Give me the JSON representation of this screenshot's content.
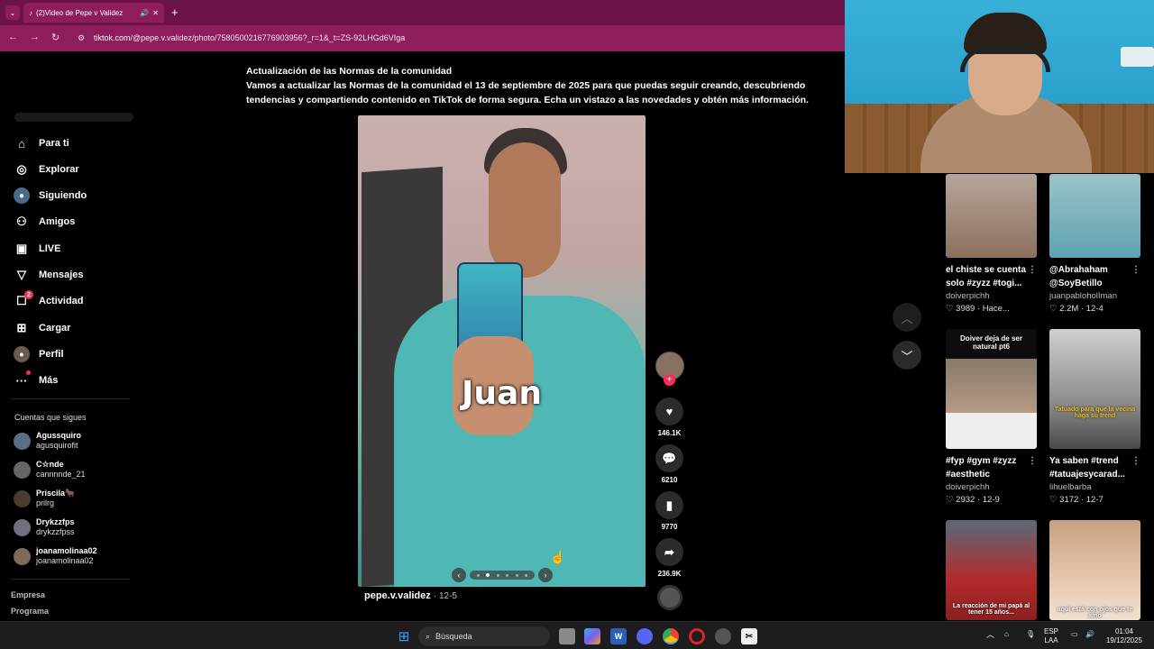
{
  "browser": {
    "tab_title": "(2)Video de Pepe v Validez",
    "url_host": "tiktok.com",
    "url_path": "/@pepe.v.validez/photo/7580500216776903956?_r=1&_t=ZS-92LHGd6VIga"
  },
  "notice": {
    "title": "Actualización de las Normas de la comunidad",
    "body": "Vamos a actualizar las Normas de la comunidad el 13 de septiembre de 2025 para que puedas seguir creando, descubriendo tendencias y compartiendo contenido en TikTok de forma segura. Echa un vistazo a las novedades y obtén más información."
  },
  "sidebar": {
    "items": [
      {
        "label": "Para ti",
        "icon": "home-icon"
      },
      {
        "label": "Explorar",
        "icon": "compass-icon"
      },
      {
        "label": "Siguiendo",
        "icon": "following-icon"
      },
      {
        "label": "Amigos",
        "icon": "friends-icon"
      },
      {
        "label": "LIVE",
        "icon": "live-icon"
      },
      {
        "label": "Mensajes",
        "icon": "send-icon"
      },
      {
        "label": "Actividad",
        "icon": "activity-icon",
        "badge": "2"
      },
      {
        "label": "Cargar",
        "icon": "upload-icon"
      },
      {
        "label": "Perfil",
        "icon": "profile-icon"
      },
      {
        "label": "Más",
        "icon": "more-icon"
      }
    ],
    "following_header": "Cuentas que sigues",
    "following": [
      {
        "name": "Agussquiro",
        "user": "agusquirofit"
      },
      {
        "name": "C☆nde",
        "user": "cannnnde_21"
      },
      {
        "name": "Priscila🐂",
        "user": "prilrg"
      },
      {
        "name": "Drykzzfps",
        "user": "drykzzfpss"
      },
      {
        "name": "joanamolinaa02",
        "user": "joanamolinaa02"
      }
    ],
    "footer": [
      "Empresa",
      "Programa"
    ]
  },
  "post": {
    "caption": "Juan",
    "author": "pepe.v.validez",
    "date": "12-5",
    "carousel_total": 6,
    "carousel_current": 2,
    "likes": "146.1K",
    "comments": "6210",
    "saves": "9770",
    "shares": "236.9K"
  },
  "grid": [
    {
      "title": "el chiste se cuenta solo #zyzz #togi...",
      "author": "doiverpichh",
      "stats": "♡ 3989 · Hace...",
      "overlay": ""
    },
    {
      "title": "@Abrahaham @SoyBetillo",
      "author": "juanpabloholIman",
      "stats": "♡ 2.2M · 12-4",
      "overlay": ""
    },
    {
      "title": "#fyp #gym #zyzz #aesthetic",
      "author": "doiverpichh",
      "stats": "♡ 2932 · 12-9",
      "overlay": "Doiver deja de ser natural pt6"
    },
    {
      "title": "Ya saben #trend #tatuajesycarad...",
      "author": "lihuelbarba",
      "stats": "♡ 3172 · 12-7",
      "overlay": "Tatuado para que la vecina haga su trend"
    },
    {
      "title": "",
      "author": "",
      "stats": "",
      "overlay": "La reacción de mi papá al tener 15 años..."
    },
    {
      "title": "",
      "author": "",
      "stats": "",
      "overlay": "aquí está con ojos que te amo"
    }
  ],
  "taskbar": {
    "search_placeholder": "Búsqueda",
    "lang_1": "ESP",
    "lang_2": "LAA",
    "time": "01:04",
    "date": "19/12/2025"
  },
  "colors": {
    "browser_tab": "#6b1346",
    "browser_bar": "#8e1d5c",
    "tiktok_red": "#fe2c55",
    "background": "#000000"
  }
}
